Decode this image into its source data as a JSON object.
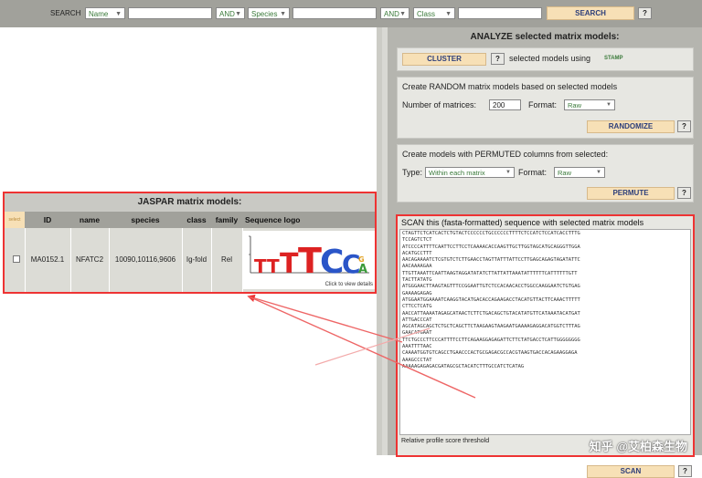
{
  "search": {
    "label": "SEARCH",
    "field1": "Name",
    "op1": "AND",
    "field2": "Species",
    "op2": "AND",
    "field3": "Class",
    "button": "SEARCH",
    "help": "?"
  },
  "analyze": {
    "title": "ANALYZE selected matrix models:",
    "cluster_button": "CLUSTER",
    "cluster_help": "?",
    "cluster_text": "selected models using",
    "stamp": "STAMP"
  },
  "random": {
    "title": "Create RANDOM matrix models based on selected models",
    "num_label": "Number of matrices:",
    "num_value": "200",
    "format_label": "Format:",
    "format_value": "Raw",
    "button": "RANDOMIZE",
    "help": "?"
  },
  "permuted": {
    "title": "Create models with PERMUTED columns from selected:",
    "type_label": "Type:",
    "type_value": "Within each matrix",
    "format_label": "Format:",
    "format_value": "Raw",
    "button": "PERMUTE",
    "help": "?"
  },
  "scan": {
    "title": "SCAN this (fasta-formatted) sequence with selected matrix models",
    "sequence_lines": [
      "CTAGTTCTCATCACTCTGTACTCCCCCCTGCCCCCCTTTTCTCCATCTCCATCACCTTTG",
      "TCCAGTCTCT",
      "ATCCCCATTTTCAATTCCTTCCTCAAAACACCAAGTTGCTTGGTAGCATGCAGGGTTGGA",
      "ACATGCCTTT",
      "AACAGAAAATCTCGTGTCTCTTGAACCTAGTTATTTATTCCTTGAGCAGAGTAGATATTC",
      "AACAAAAGAA",
      "TTGTTAAATTCAATTAAGTAGGATATATCTTATTATTAAATATTTTTTCATTTTTTGTT",
      "TACTTATATG",
      "ATGGGAACTTAAGTAGTTTCCGGAATTGTCTCCACAACACCTGGCCAAGGAATCTGTGAG",
      "GAAAAGAGAG",
      "ATGGAATGGAAAATCAAGGTACATGACACCAGAAGACCTACATGTTACTTCAAACTTTTT",
      "CTTCCTCATG",
      "AACCATTAAAATAGAGCATAACTCTTCTGACAGCTGTACATATGTTCATAAATACATGAT",
      "ATTGACCCAT",
      "AGCATAGCAGCTCTGCTCAGCTTCTAAGAAGTAAGAATGAAAAGAGGACATGGTCTTTAG",
      "GAACATGAAT",
      "TTCTGCCCTTCCCATTTTCCTTCAGAAGGAGAGATTCTTCTATGACCTCATTGGGGGGGG",
      "AAATTTTAAC",
      "CAAAATGGTGTCAGCCTGAACCCACTGCGAGACGCCACGTAAGTGACCACAGAAGGAGA",
      "AAAGCCCTAT",
      "AAAAAGAGAGACGATAGCGCTACATCTTTGCCATCTCATAG"
    ],
    "threshold_label": "Relative profile score threshold",
    "button": "SCAN",
    "help": "?"
  },
  "jaspar": {
    "title": "JASPAR matrix models:",
    "columns": [
      "select",
      "ID",
      "name",
      "species",
      "class",
      "family",
      "Sequence logo"
    ],
    "row": {
      "id": "MA0152.1",
      "name": "NFATC2",
      "species": "10090,10116,9606",
      "class": "Ig-fold",
      "family": "Rel",
      "logo_caption": "Click to view details"
    }
  },
  "watermark": "知乎 @艾柏森生物"
}
